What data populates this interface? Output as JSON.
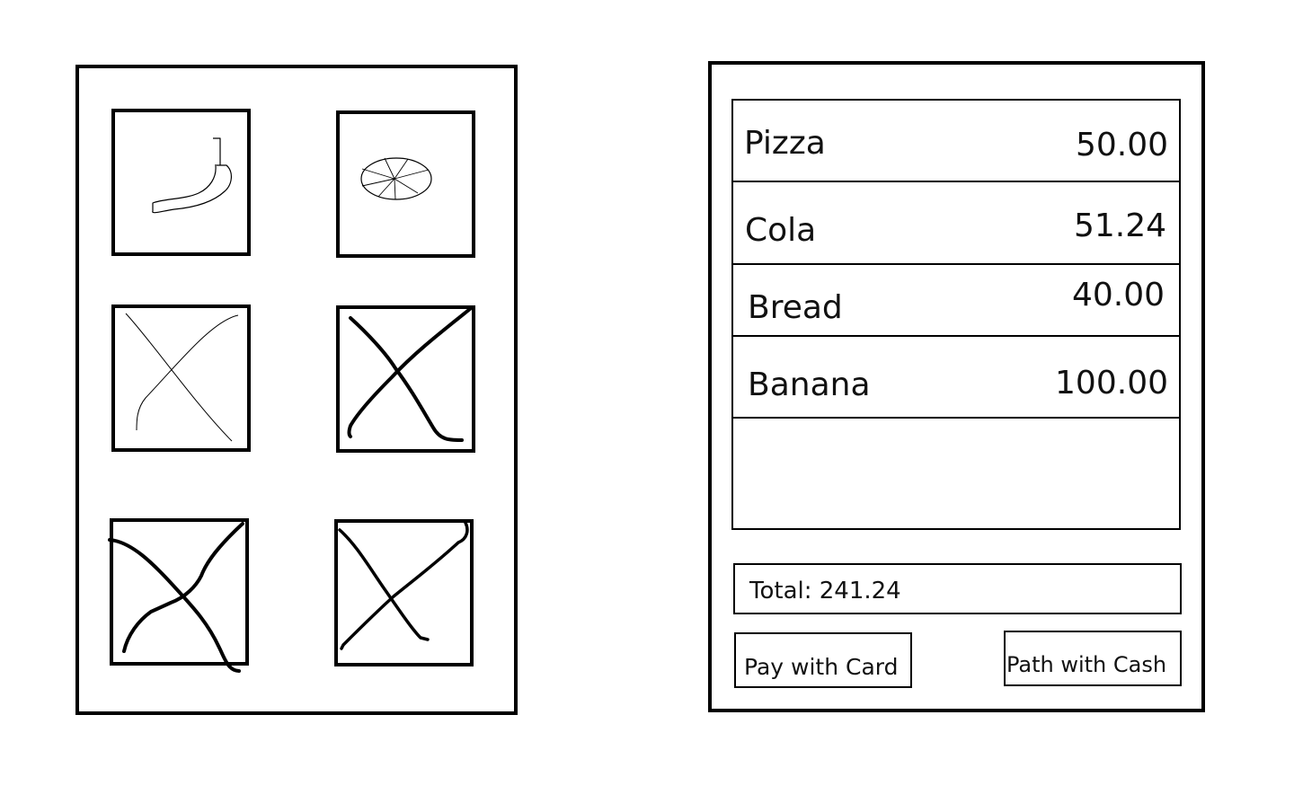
{
  "product_grid": {
    "tiles": [
      {
        "icon": "banana-icon"
      },
      {
        "icon": "pizza-icon"
      },
      {
        "icon": "placeholder-x-icon"
      },
      {
        "icon": "placeholder-x-icon"
      },
      {
        "icon": "placeholder-x-icon"
      },
      {
        "icon": "placeholder-x-icon"
      }
    ]
  },
  "order": {
    "items": [
      {
        "name": "Pizza",
        "price": "50.00"
      },
      {
        "name": "Cola",
        "price": "51.24"
      },
      {
        "name": "Bread",
        "price": "40.00"
      },
      {
        "name": "Banana",
        "price": "100.00"
      }
    ],
    "total_label": "Total: 241.24"
  },
  "buttons": {
    "card_label": "Pay with Card",
    "cash_label": "Path with Cash"
  }
}
